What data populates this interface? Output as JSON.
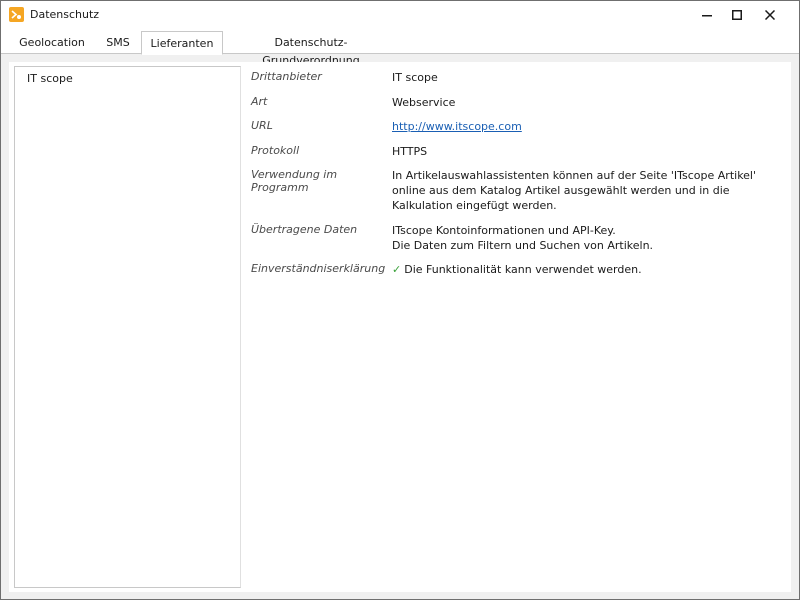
{
  "window": {
    "title": "Datenschutz"
  },
  "tabs": [
    {
      "label": "Geolocation",
      "active": false
    },
    {
      "label": "SMS",
      "active": false
    },
    {
      "label": "Lieferanten",
      "active": true
    },
    {
      "label": "Datenschutz-Grundverordnung",
      "active": false
    }
  ],
  "list": {
    "items": [
      "IT scope"
    ]
  },
  "details": {
    "drittanbieter": {
      "label": "Drittanbieter",
      "value": "IT scope"
    },
    "art": {
      "label": "Art",
      "value": "Webservice"
    },
    "url": {
      "label": "URL",
      "value": "http://www.itscope.com"
    },
    "protokoll": {
      "label": "Protokoll",
      "value": "HTTPS"
    },
    "verwendung": {
      "label": "Verwendung im Programm",
      "value": "In Artikelauswahlassistenten können auf der Seite 'ITscope Artikel' online aus dem Katalog Artikel ausgewählt werden und in die Kalkulation eingefügt werden."
    },
    "daten": {
      "label": "Übertragene Daten",
      "line1": "ITscope Kontoinformationen und API-Key.",
      "line2": "Die Daten zum Filtern und Suchen von Artikeln."
    },
    "einverstaendnis": {
      "label": "Einverständniserklärung",
      "check_symbol": "✓",
      "value": "Die Funktionalität kann verwendet werden."
    }
  },
  "colors": {
    "accent": "#f5a623",
    "link": "#1a5fb4",
    "check": "#3aa13a"
  }
}
